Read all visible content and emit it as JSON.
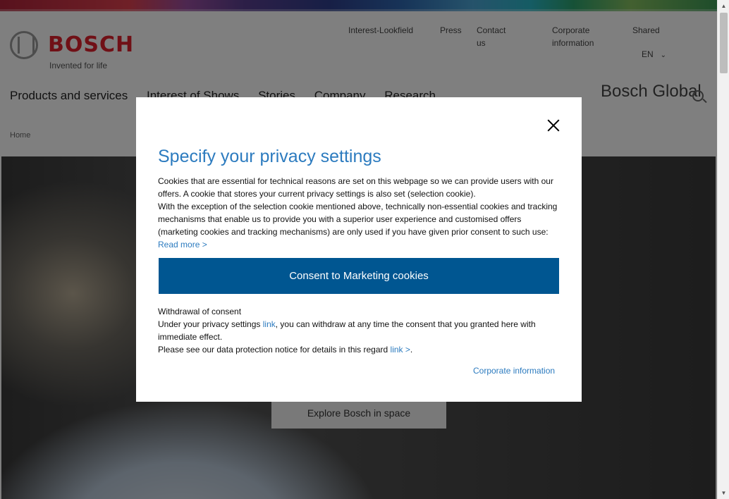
{
  "site": {
    "logo_text": "BOSCH",
    "tagline": "Invented for life",
    "meta_links": [
      "Interest-Lookfield",
      "Press",
      "Contact us",
      "Corporate information"
    ],
    "meta_right": "Shared",
    "language": "EN",
    "main_nav": [
      "Products and services",
      "Interest of Shows",
      "Stories",
      "Company",
      "Research"
    ],
    "site_name": "Bosch Global",
    "breadcrumb": "Home",
    "hero_button": "Explore Bosch in space"
  },
  "modal": {
    "title": "Specify your privacy settings",
    "paragraph1": "Cookies that are essential for technical reasons are set on this webpage so we can provide users with our offers. A cookie that stores your current privacy settings is also set (selection cookie).",
    "paragraph2": "With the exception of the selection cookie mentioned above, technically non-essential cookies and tracking mechanisms that enable us to provide you with a superior user experience and customised offers (marketing cookies and tracking mechanisms) are only used if you have given prior consent to such use:",
    "read_more": "Read more >",
    "consent_button": "Consent to Marketing cookies",
    "withdrawal_heading": "Withdrawal of consent",
    "withdrawal_text_a": "Under your privacy settings ",
    "withdrawal_link": "link",
    "withdrawal_text_b": ", you can withdraw at any time the consent that you granted here with immediate effect.",
    "protection_text": "Please see our data protection notice for details in this regard ",
    "protection_link": "link >",
    "protection_end": ".",
    "corporate_link": "Corporate information"
  },
  "colors": {
    "accent": "#2c7bbf",
    "button_bg": "#005691",
    "brand_red": "#e0202d"
  }
}
